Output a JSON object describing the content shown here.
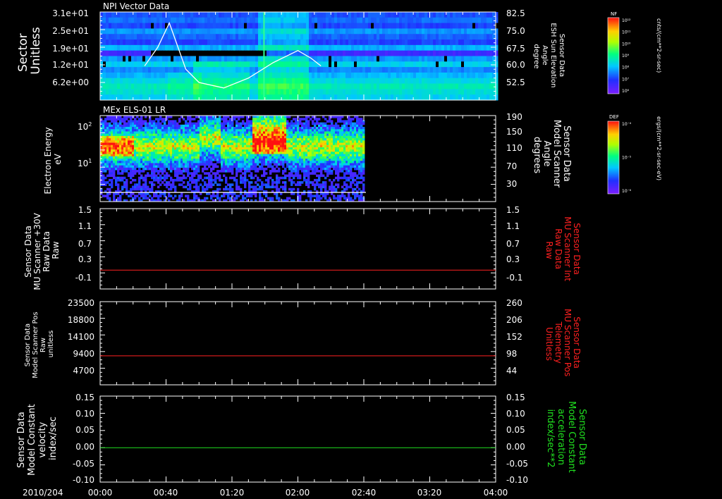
{
  "date_label": "2010/204",
  "x_ticks": [
    "00:00",
    "00:40",
    "01:20",
    "02:00",
    "02:40",
    "03:20",
    "04:00"
  ],
  "chart_data": [
    {
      "type": "heatmap",
      "title": "NPI Vector Data",
      "ylabel": [
        "Sector",
        "Unitless"
      ],
      "y_ticks": [
        "3.1e+01",
        "2.5e+01",
        "1.9e+01",
        "1.2e+01",
        "6.2e+00"
      ],
      "y2label": [
        "Sensor Data",
        "ESH Sun Elevation",
        "Angle",
        "degree"
      ],
      "y2_ticks": [
        "82.5",
        "75.0",
        "67.5",
        "60.0",
        "52.5"
      ],
      "line": {
        "name": "ESH Sun Elevation Angle",
        "color": "#ffffff",
        "x": [
          "00:27",
          "00:35",
          "00:42",
          "00:52",
          "01:00",
          "01:15",
          "01:30",
          "01:45",
          "02:00",
          "02:08",
          "02:14"
        ],
        "y": [
          61.5,
          70,
          81,
          60,
          54,
          51.5,
          56,
          63,
          68.5,
          65,
          61.5
        ],
        "ylim": [
          46,
          86
        ]
      },
      "colorbar": {
        "title": "NF",
        "units": "cnts/(cm**2-sr-sec)",
        "ticks": [
          "10¹²",
          "10¹¹",
          "10¹⁰",
          "10⁹",
          "10⁸",
          "10⁷",
          "10⁶"
        ]
      }
    },
    {
      "type": "heatmap",
      "title": "MEx ELS-01 LR",
      "ylabel": [
        "Electron Energy",
        "eV"
      ],
      "y_ticks": [
        "10²",
        "10¹"
      ],
      "y2label": [
        "Sensor Data",
        "Model Scanner",
        "Angle",
        "degrees"
      ],
      "y2_ticks": [
        "190",
        "150",
        "110",
        "70",
        "30"
      ],
      "data_end": "02:40",
      "line": {
        "name": "Model Scanner Angle",
        "color": "#ffffff",
        "x": [
          "00:00",
          "02:40"
        ],
        "y": [
          10,
          10
        ],
        "ylim": [
          -10,
          190
        ]
      },
      "colorbar": {
        "title": "DEF",
        "units": "ergs/(cm**2-sr-sec-eV)",
        "ticks": [
          "10⁻⁴",
          "10⁻⁵",
          "10⁻⁶"
        ]
      }
    },
    {
      "type": "line",
      "ylabel": [
        "Sensor Data",
        "MU Scanner +30V",
        "Raw Data",
        "Raw"
      ],
      "y_ticks": [
        "1.5",
        "1.1",
        "0.7",
        "0.3",
        "-0.1"
      ],
      "y2label": [
        "Sensor Data",
        "MU Scanner Int",
        "Raw Data",
        "Raw"
      ],
      "y2_color": "#ff2020",
      "y2_ticks": [
        "1.5",
        "1.1",
        "0.7",
        "0.3",
        "-0.1"
      ],
      "series": [
        {
          "color": "#ff2020",
          "x": [
            "00:00",
            "04:00"
          ],
          "y": [
            -0.03,
            -0.03
          ]
        }
      ],
      "ylim": [
        -0.5,
        1.5
      ]
    },
    {
      "type": "line",
      "ylabel": [
        "Sensor Data",
        "Model Scanner Pos",
        "Raw",
        "unitless"
      ],
      "y_ticks": [
        "23500",
        "18800",
        "14100",
        "9400",
        "4700"
      ],
      "y2label": [
        "Sensor Data",
        "MU Scanner Pos",
        "Telemetry",
        "Unitless"
      ],
      "y2_color": "#ff2020",
      "y2_ticks": [
        "260",
        "206",
        "152",
        "98",
        "44"
      ],
      "series": [
        {
          "color": "#ff2020",
          "x": [
            "00:00",
            "04:00"
          ],
          "y": [
            8200,
            8200
          ]
        }
      ],
      "ylim": [
        0,
        23500
      ]
    },
    {
      "type": "line",
      "ylabel": [
        "Sensor Data",
        "Model Constant",
        "velocity",
        "index/sec"
      ],
      "y_ticks": [
        "0.15",
        "0.10",
        "0.05",
        "0.00",
        "-0.05",
        "-0.10"
      ],
      "y2label": [
        "Sensor Data",
        "Model Constant",
        "acceleration",
        "index/sec**2"
      ],
      "y2_color": "#20e020",
      "y2_ticks": [
        "0.15",
        "0.10",
        "0.05",
        "0.00",
        "-0.05",
        "-0.10"
      ],
      "series": [
        {
          "color": "#20e020",
          "x": [
            "00:00",
            "04:00"
          ],
          "y": [
            0.0,
            0.0
          ]
        }
      ],
      "ylim": [
        -0.1,
        0.15
      ]
    }
  ]
}
